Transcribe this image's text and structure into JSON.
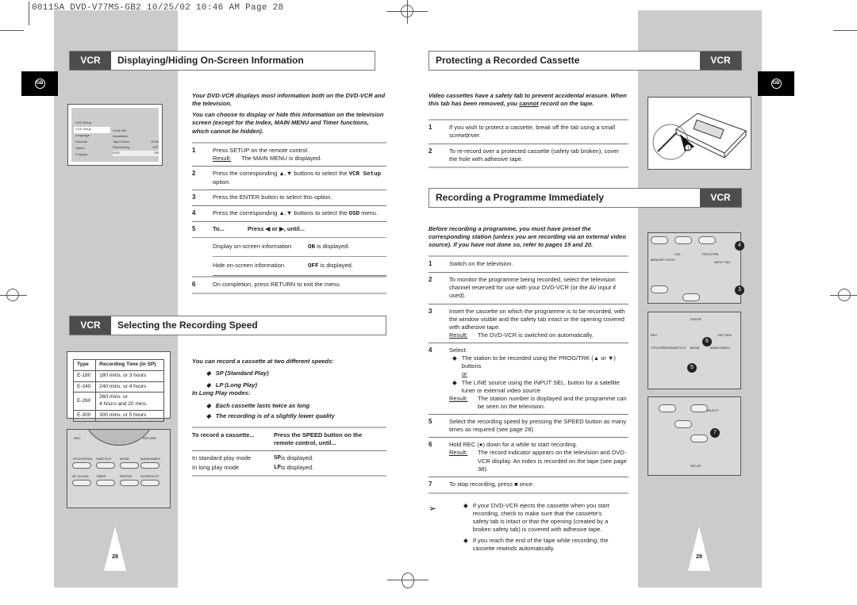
{
  "slug": "00115A DVD-V77MS-GB2   10/25/02 10:46 AM   Page 28",
  "lang_badge": "GB",
  "left": {
    "page_number": "28",
    "section1": {
      "tag": "VCR",
      "title": "Displaying/Hiding On-Screen Information",
      "intro1": "Your DVD-VCR displays most information both on the DVD-VCR and the television.",
      "intro2": "You can choose to display or hide this information on the television screen (except for the Index, MAIN MENU and Timer functions, which cannot be hidden).",
      "steps": [
        {
          "n": "1",
          "text": "Press SETUP on the remote control.",
          "result_label": "Result:",
          "result": "The MAIN MENU is displayed."
        },
        {
          "n": "2",
          "pre": "Press the corresponding ▲,▼ buttons to select the ",
          "code": "VCR Setup",
          "post": " option."
        },
        {
          "n": "3",
          "text": "Press the ENTER button to select this option."
        },
        {
          "n": "4",
          "pre": "Press the corresponding ▲,▼ buttons to select the ",
          "code": "OSD",
          "post": " menu."
        },
        {
          "n": "5",
          "col1": "To...",
          "col2": "Press ◀ or ▶, until..."
        },
        {
          "n": "6",
          "text": "On completion, press RETURN to exit the menu."
        }
      ],
      "rows": [
        {
          "label": "Display on-screen information",
          "code": "ON",
          "suffix": " is displayed."
        },
        {
          "label": "Hide on-screen information",
          "code": "OFF",
          "suffix": " is displayed."
        }
      ],
      "menu": {
        "items": [
          "DVD Setup",
          "VCR Setup",
          "Language",
          "Parental",
          "Option",
          "Program"
        ],
        "sub": [
          [
            "Clock Set",
            ""
          ],
          [
            "Installation",
            ""
          ],
          [
            "Tape Select",
            "E180"
          ],
          [
            "Repeat play",
            "OFF"
          ],
          [
            "OSD",
            "ON"
          ]
        ]
      }
    },
    "section2": {
      "tag": "VCR",
      "title": "Selecting the Recording Speed",
      "table": {
        "headers": [
          "Type",
          "Recording Time (in SP)"
        ],
        "rows": [
          [
            "E-180",
            "180 mins. or 3 hours"
          ],
          [
            "E-240",
            "240 mins. or 4 hours"
          ],
          [
            "E-260",
            "260 mins. or\n4 hours and 20 mins."
          ],
          [
            "E-300",
            "300 mins. or 5 hours"
          ]
        ]
      },
      "intro": "You can record a cassette at two different speeds:",
      "speeds": [
        "SP (Standard Play)",
        "LP (Long Play)"
      ],
      "lp_heading": "In Long Play modes:",
      "lp_notes": [
        "Each cassette lasts twice as long",
        "The recording is of a slightly lower quality"
      ],
      "col1": "To record a cassette...",
      "col2": "Press the SPEED button on the remote control, until...",
      "rows": [
        {
          "label": "In standard play mode",
          "code": "SP",
          "suffix": " is displayed."
        },
        {
          "label": "In long play mode",
          "code": "LP",
          "suffix": " is displayed."
        }
      ],
      "remote_labels": [
        "REC",
        "RETURN",
        "TITLE/SPEED",
        "SUBTITLE",
        "MODE",
        "MARK/INDEX",
        "3D SOUND",
        "TIMER",
        "REPEAT",
        "SCREEN FIT"
      ]
    }
  },
  "right": {
    "page_number": "29",
    "section1": {
      "tag": "VCR",
      "title": "Protecting a Recorded Cassette",
      "intro_pre": "Video cassettes have a safety tab to prevent accidental erasure. When this tab has been removed, you ",
      "intro_u": "cannot",
      "intro_post": " record on the tape.",
      "steps": [
        {
          "n": "1",
          "text": "If you wish to protect a cassette, break off the tab using a small screwdriver."
        },
        {
          "n": "2",
          "text": "To re-record over a protected cassette (safety tab broken), cover the hole with adhesive tape."
        }
      ],
      "callout": "1"
    },
    "section2": {
      "tag": "VCR",
      "title": "Recording a Programme Immediately",
      "intro": "Before recording a programme, you must have preset the corresponding station (unless you are recording via an external video source). If you have not done so, refer to pages 19 and 20.",
      "steps": [
        {
          "n": "1",
          "text": "Switch on the television."
        },
        {
          "n": "2",
          "text": "To monitor the programme being recorded, select the television channel reserved for use with your DVD-VCR (or the AV input if used)."
        },
        {
          "n": "3",
          "text": "Insert the cassette on which the programme is to be recorded, with the window visible and the safety tab intact or the opening covered with adhesive tape.",
          "result_label": "Result:",
          "result": "The DVD-VCR is switched on automatically."
        },
        {
          "n": "4",
          "text": "Select:",
          "bullet1": "The station to be recorded using the PROG/TRK (▲ or ▼) buttons",
          "or": "or",
          "bullet2": "The LINE source using the INPUT SEL. button for a satellite tuner or external video source",
          "result_label": "Result:",
          "result": "The station number is displayed and the programme can be seen on the television."
        },
        {
          "n": "5",
          "text": "Select the recording speed by pressing the SPEED button as many times as required (see page 28)."
        },
        {
          "n": "6",
          "text": "Hold REC (●) down for a while to start recording.",
          "result_label": "Result:",
          "result": "The record indicator appears on the television and DVD-VCR display. An index is recorded on the tape (see page 38)."
        },
        {
          "n": "7",
          "text": "To stop recording, press ■ once."
        }
      ],
      "notes": [
        "If your DVD-VCR ejects the cassette when you start recording, check to make sure that the cassette's safety tab is intact or that the opening (created by a broken safety tab) is covered with adhesive tape.",
        "If you reach the end of the tape while recording, the cassette rewinds automatically."
      ],
      "remote_labels": [
        "VOL",
        "PROG/TRK",
        "MEMORY STICK",
        "INPUT SEL.",
        "ENTER",
        "REC",
        "RETURN",
        "TITLE/SPEED",
        "SUBTITLE",
        "MODE",
        "MARK/INDEX",
        "SETUP",
        "SELECT"
      ],
      "callouts": [
        "4",
        "3",
        "6",
        "5",
        "7"
      ]
    }
  }
}
